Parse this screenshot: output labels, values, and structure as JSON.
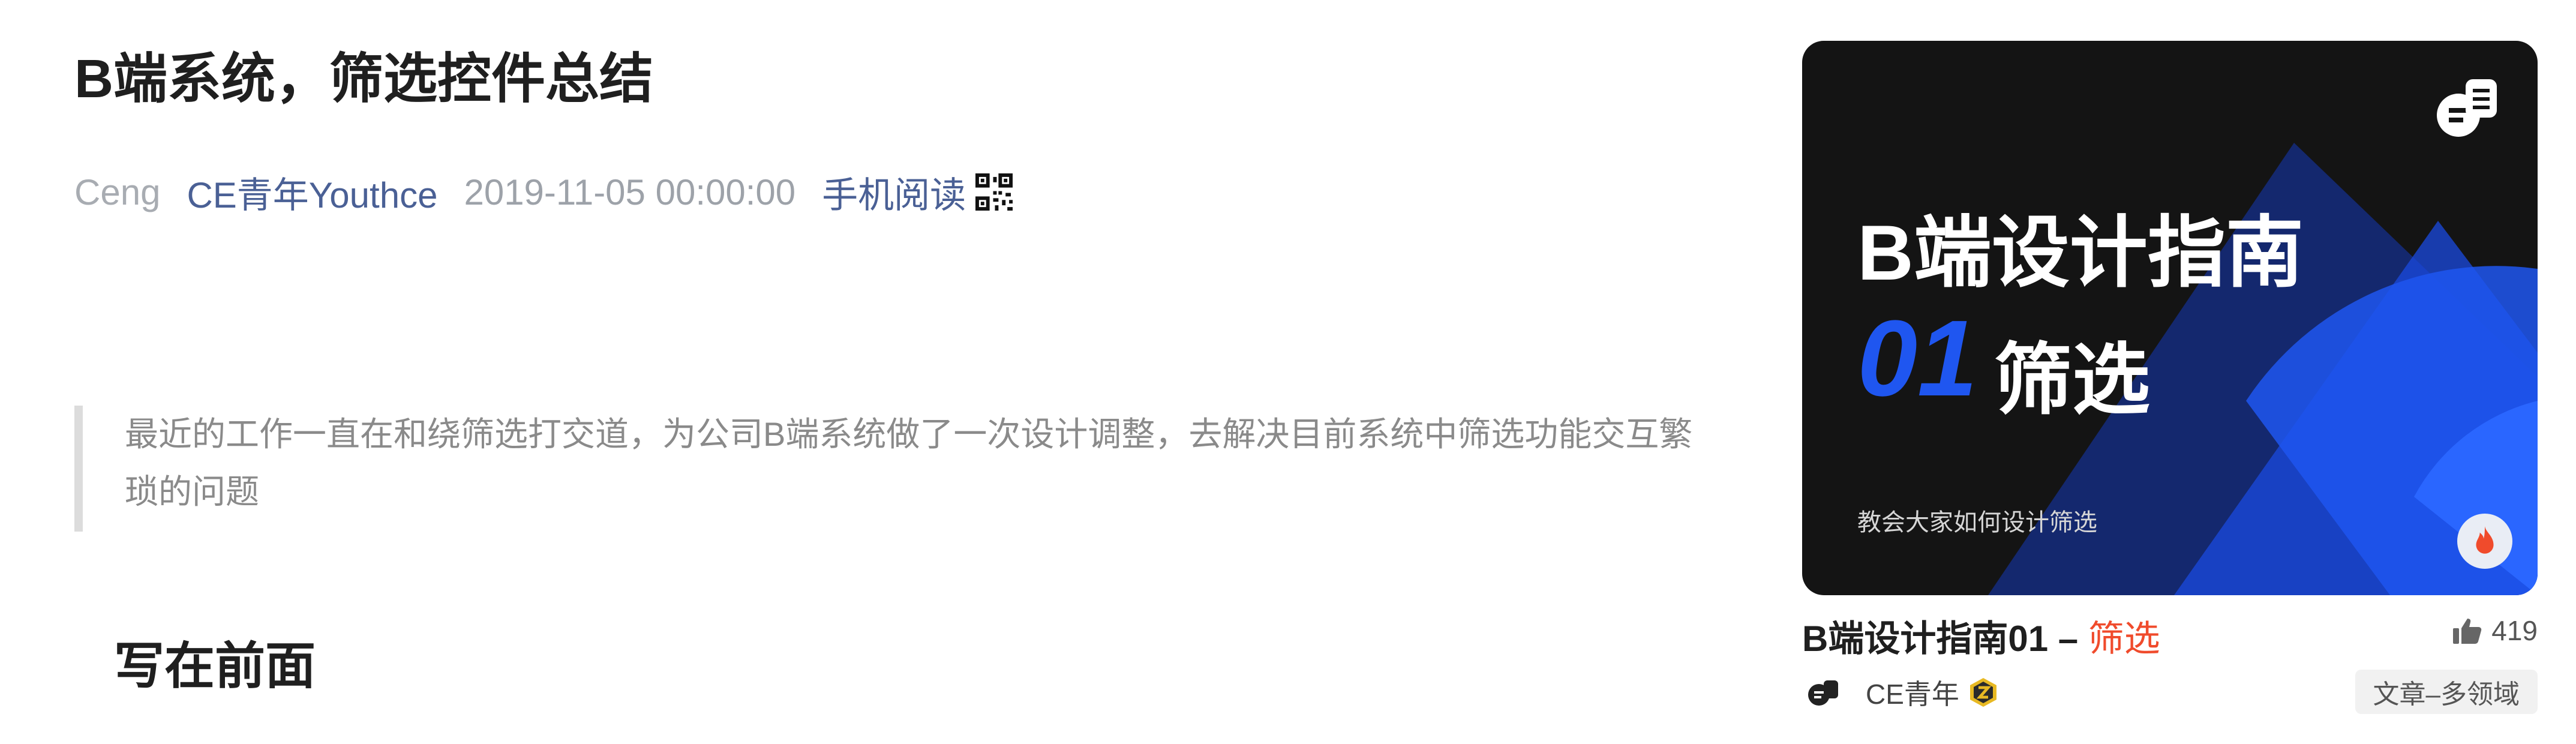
{
  "article": {
    "title": "B端系统，筛选控件总结",
    "meta": {
      "author": "Ceng",
      "source": "CE青年Youthce",
      "date": "2019-11-05 00:00:00",
      "mobile_read": "手机阅读"
    },
    "summary": "最近的工作一直在和绕筛选打交道，为公司B端系统做了一次设计调整，去解决目前系统中筛选功能交互繁琐的问题",
    "section_heading": "写在前面"
  },
  "side_card": {
    "cover": {
      "headline": "B端设计指南",
      "number": "01",
      "keyword": "筛选",
      "subtitle": "教会大家如何设计筛选"
    },
    "title_main": "B端设计指南01 – ",
    "title_highlight": "筛选",
    "likes": "419",
    "author": "CE青年",
    "tag": "文章–多领域",
    "colors": {
      "accent": "#1f56f0",
      "highlight": "#f04b2c",
      "cover_bg": "#141414"
    },
    "icons": [
      "thumb-up-icon",
      "fire-icon",
      "badge-icon",
      "qr-code-icon"
    ]
  }
}
